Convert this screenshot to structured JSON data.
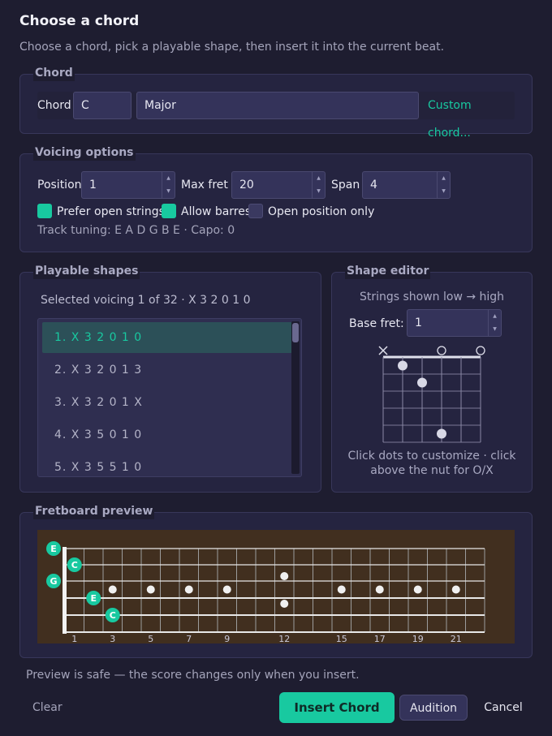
{
  "dialog": {
    "title": "Choose a chord",
    "subtitle": "Choose a chord, pick a playable shape, then insert it into the current beat."
  },
  "chord_group": {
    "title": "Chord",
    "chord_label": "Chord",
    "root_value": "C",
    "quality_value": "Major",
    "custom_button": "Custom chord..."
  },
  "voicing": {
    "title": "Voicing options",
    "position_label": "Position",
    "position_value": "1",
    "max_fret_label": "Max fret",
    "max_fret_value": "20",
    "span_label": "Span",
    "span_value": "4",
    "options": [
      {
        "label": "Prefer open strings",
        "checked": true
      },
      {
        "label": "Allow barres",
        "checked": true
      },
      {
        "label": "Open position only",
        "checked": false
      }
    ],
    "tuning_text": "Track tuning: E A D G B E · Capo: 0"
  },
  "shapes": {
    "title": "Playable shapes",
    "selected_text": "Selected voicing 1 of 32 · X  3  2  0  1  0",
    "items": [
      "1.  X  3  2  0  1  0",
      "2.  X  3  2  0  1  3",
      "3.  X  3  2  0  1  X",
      "4.  X  3  5  0  1  0",
      "5.  X  3  5  5  1  0"
    ],
    "selected_index": 0
  },
  "editor": {
    "title": "Shape editor",
    "strings_hint": "Strings shown low → high",
    "base_fret_label": "Base fret:",
    "base_fret_value": "1",
    "help_line1": "Click dots to customize · click",
    "help_line2": "above the nut for O/X",
    "string_markers": [
      "x",
      "",
      "",
      "o",
      "",
      "o"
    ],
    "fingered": [
      [
        2,
        1
      ],
      [
        3,
        2
      ],
      [
        4,
        5
      ]
    ],
    "frets_shown": 5
  },
  "fretboard": {
    "title": "Fretboard preview",
    "fret_numbers": [
      "1",
      "3",
      "5",
      "7",
      "9",
      "12",
      "15",
      "17",
      "19",
      "21"
    ],
    "fret_number_positions": [
      1,
      3,
      5,
      7,
      9,
      12,
      15,
      17,
      19,
      21
    ],
    "inlay_frets": [
      3,
      5,
      7,
      9,
      15,
      17,
      19,
      21
    ],
    "double_inlay_fret": 12,
    "notes": [
      {
        "string": 1,
        "fret": 0,
        "label": "E"
      },
      {
        "string": 2,
        "fret": 1,
        "label": "C"
      },
      {
        "string": 3,
        "fret": 0,
        "label": "G"
      },
      {
        "string": 4,
        "fret": 2,
        "label": "E"
      },
      {
        "string": 5,
        "fret": 3,
        "label": "C"
      }
    ],
    "colors": {
      "wood": "#412f1f",
      "note": "#18c9a0"
    }
  },
  "footer": {
    "preview_note": "Preview is safe — the score changes only when you insert.",
    "clear": "Clear",
    "insert": "Insert Chord",
    "audition": "Audition",
    "cancel": "Cancel"
  },
  "colors": {
    "accent": "#18c9a0",
    "background": "#1e1d30",
    "panel": "#252440"
  }
}
